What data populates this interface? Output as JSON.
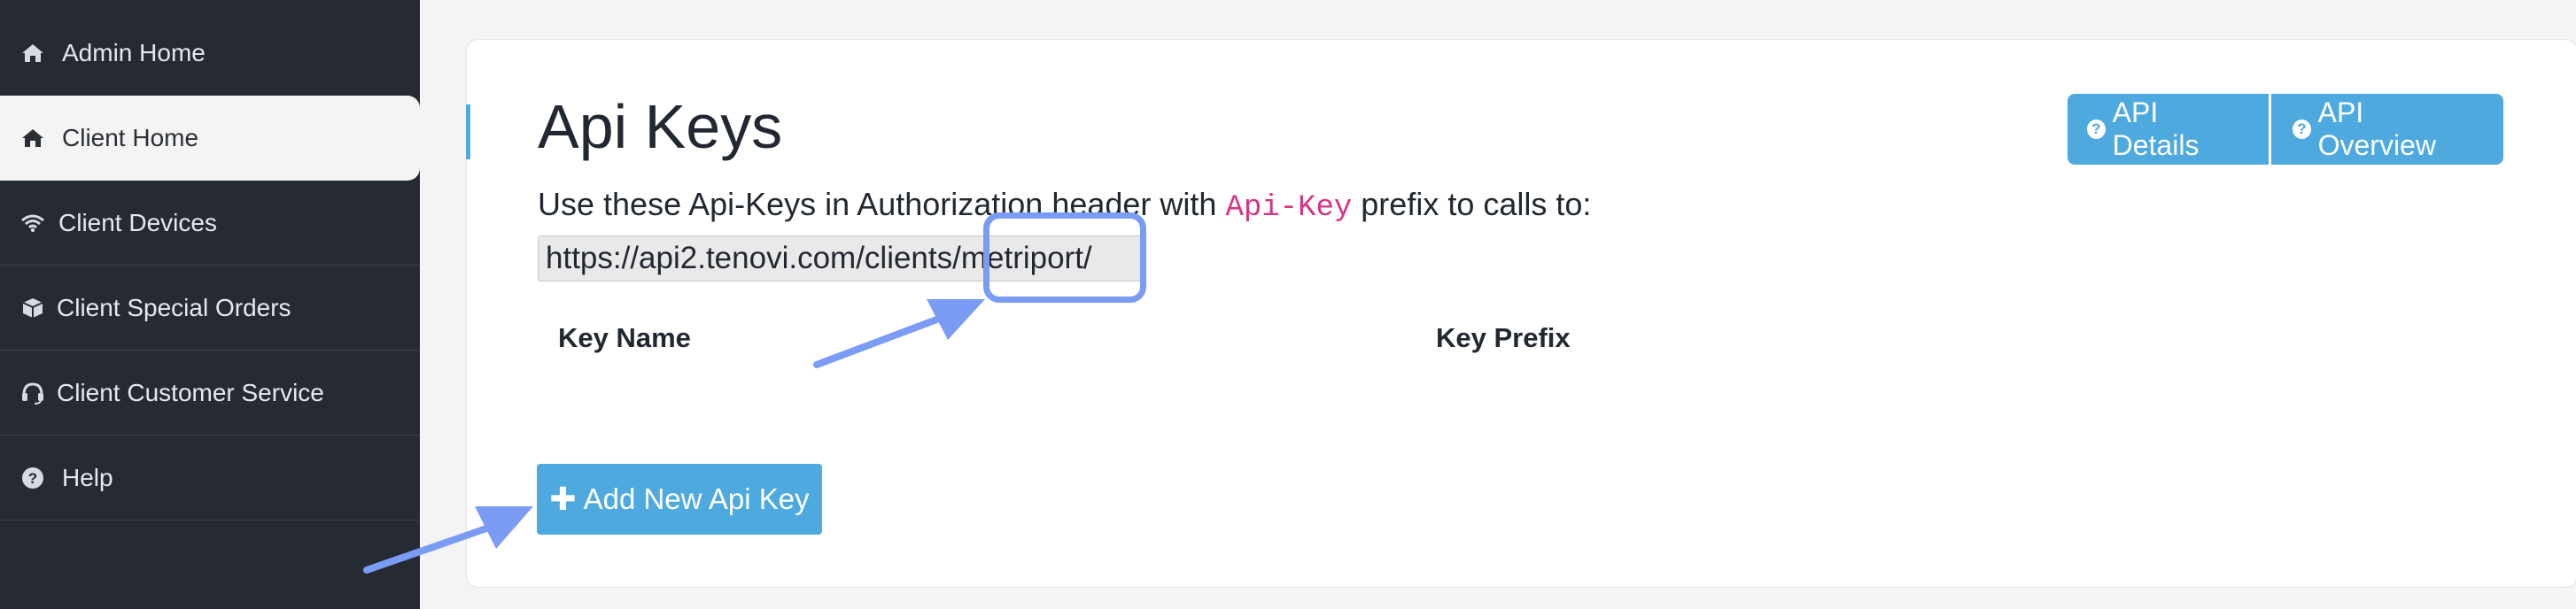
{
  "sidebar": {
    "items": [
      {
        "label": "Admin Home",
        "icon": "home-icon",
        "active": false
      },
      {
        "label": "Client Home",
        "icon": "home-icon",
        "active": true
      },
      {
        "label": "Client Devices",
        "icon": "wifi-icon",
        "active": false
      },
      {
        "label": "Client Special Orders",
        "icon": "box-icon",
        "active": false
      },
      {
        "label": "Client Customer Service",
        "icon": "headset-icon",
        "active": false
      },
      {
        "label": "Help",
        "icon": "question-circle-icon",
        "active": false
      }
    ]
  },
  "main": {
    "title": "Api Keys",
    "description_before": "Use these Api-Keys in Authorization header with ",
    "description_code": "Api-Key",
    "description_after": " prefix to calls to:",
    "url": "https://api2.tenovi.com/clients/metriport/",
    "table": {
      "columns": [
        "Key Name",
        "Key Prefix"
      ],
      "rows": []
    },
    "buttons": {
      "api_details": "API Details",
      "api_overview": "API Overview",
      "add_key": "Add New Api Key"
    }
  },
  "colors": {
    "sidebar_bg": "#262b33",
    "accent": "#4ea9df",
    "code_text": "#d63384",
    "annotation": "#7b9cf5"
  }
}
